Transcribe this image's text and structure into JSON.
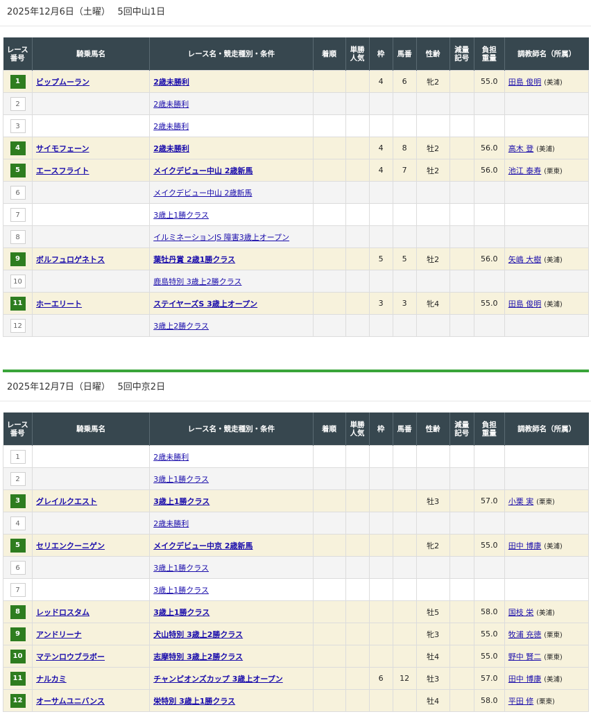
{
  "headers": {
    "race_no": [
      "レース",
      "番号"
    ],
    "horse": "騎乗馬名",
    "race": "レース名・競走種別・条件",
    "finish": "着順",
    "pop": [
      "単勝",
      "人気"
    ],
    "waku": "枠",
    "umaban": "馬番",
    "sexage": "性齢",
    "reduce": [
      "減量",
      "記号"
    ],
    "weight": [
      "負担",
      "重量"
    ],
    "trainer": "調教師名（所属）"
  },
  "days": [
    {
      "title": "2025年12月6日（土曜）　 5回中山1日",
      "rows": [
        {
          "no": "1",
          "on": true,
          "horse": "ビップムーラン",
          "race": "2歳未勝利",
          "strong": true,
          "finish": "",
          "pop": "",
          "waku": "4",
          "umaban": "6",
          "sexage": "牝2",
          "reduce": "",
          "weight": "55.0",
          "trainer": "田島 俊明",
          "aff": "(美浦)"
        },
        {
          "no": "2",
          "on": false,
          "horse": "",
          "race": "2歳未勝利",
          "strong": false,
          "finish": "",
          "pop": "",
          "waku": "",
          "umaban": "",
          "sexage": "",
          "reduce": "",
          "weight": "",
          "trainer": "",
          "aff": ""
        },
        {
          "no": "3",
          "on": false,
          "horse": "",
          "race": "2歳未勝利",
          "strong": false,
          "finish": "",
          "pop": "",
          "waku": "",
          "umaban": "",
          "sexage": "",
          "reduce": "",
          "weight": "",
          "trainer": "",
          "aff": ""
        },
        {
          "no": "4",
          "on": true,
          "horse": "サイモフェーン",
          "race": "2歳未勝利",
          "strong": true,
          "finish": "",
          "pop": "",
          "waku": "4",
          "umaban": "8",
          "sexage": "牡2",
          "reduce": "",
          "weight": "56.0",
          "trainer": "高木 登",
          "aff": "(美浦)"
        },
        {
          "no": "5",
          "on": true,
          "horse": "エースフライト",
          "race": "メイクデビュー中山 2歳新馬",
          "strong": true,
          "finish": "",
          "pop": "",
          "waku": "4",
          "umaban": "7",
          "sexage": "牡2",
          "reduce": "",
          "weight": "56.0",
          "trainer": "池江 泰寿",
          "aff": "(栗東)"
        },
        {
          "no": "6",
          "on": false,
          "horse": "",
          "race": "メイクデビュー中山 2歳新馬",
          "strong": false,
          "finish": "",
          "pop": "",
          "waku": "",
          "umaban": "",
          "sexage": "",
          "reduce": "",
          "weight": "",
          "trainer": "",
          "aff": ""
        },
        {
          "no": "7",
          "on": false,
          "horse": "",
          "race": "3歳上1勝クラス",
          "strong": false,
          "finish": "",
          "pop": "",
          "waku": "",
          "umaban": "",
          "sexage": "",
          "reduce": "",
          "weight": "",
          "trainer": "",
          "aff": ""
        },
        {
          "no": "8",
          "on": false,
          "horse": "",
          "race": "イルミネーションJS 障害3歳上オープン",
          "strong": false,
          "finish": "",
          "pop": "",
          "waku": "",
          "umaban": "",
          "sexage": "",
          "reduce": "",
          "weight": "",
          "trainer": "",
          "aff": ""
        },
        {
          "no": "9",
          "on": true,
          "horse": "ボルフュロゲネトス",
          "race": "葉牡丹賞 2歳1勝クラス",
          "strong": true,
          "finish": "",
          "pop": "",
          "waku": "5",
          "umaban": "5",
          "sexage": "牡2",
          "reduce": "",
          "weight": "56.0",
          "trainer": "矢嶋 大樹",
          "aff": "(美浦)"
        },
        {
          "no": "10",
          "on": false,
          "horse": "",
          "race": "鹿島特別 3歳上2勝クラス",
          "strong": false,
          "finish": "",
          "pop": "",
          "waku": "",
          "umaban": "",
          "sexage": "",
          "reduce": "",
          "weight": "",
          "trainer": "",
          "aff": ""
        },
        {
          "no": "11",
          "on": true,
          "horse": "ホーエリート",
          "race": "ステイヤーズS 3歳上オープン",
          "strong": true,
          "finish": "",
          "pop": "",
          "waku": "3",
          "umaban": "3",
          "sexage": "牝4",
          "reduce": "",
          "weight": "55.0",
          "trainer": "田島 俊明",
          "aff": "(美浦)"
        },
        {
          "no": "12",
          "on": false,
          "horse": "",
          "race": "3歳上2勝クラス",
          "strong": false,
          "finish": "",
          "pop": "",
          "waku": "",
          "umaban": "",
          "sexage": "",
          "reduce": "",
          "weight": "",
          "trainer": "",
          "aff": ""
        }
      ]
    },
    {
      "title": "2025年12月7日（日曜）　 5回中京2日",
      "rows": [
        {
          "no": "1",
          "on": false,
          "horse": "",
          "race": "2歳未勝利",
          "strong": false,
          "finish": "",
          "pop": "",
          "waku": "",
          "umaban": "",
          "sexage": "",
          "reduce": "",
          "weight": "",
          "trainer": "",
          "aff": ""
        },
        {
          "no": "2",
          "on": false,
          "horse": "",
          "race": "3歳上1勝クラス",
          "strong": false,
          "finish": "",
          "pop": "",
          "waku": "",
          "umaban": "",
          "sexage": "",
          "reduce": "",
          "weight": "",
          "trainer": "",
          "aff": ""
        },
        {
          "no": "3",
          "on": true,
          "horse": "グレイルクエスト",
          "race": "3歳上1勝クラス",
          "strong": true,
          "finish": "",
          "pop": "",
          "waku": "",
          "umaban": "",
          "sexage": "牡3",
          "reduce": "",
          "weight": "57.0",
          "trainer": "小栗 実",
          "aff": "(栗東)"
        },
        {
          "no": "4",
          "on": false,
          "horse": "",
          "race": "2歳未勝利",
          "strong": false,
          "finish": "",
          "pop": "",
          "waku": "",
          "umaban": "",
          "sexage": "",
          "reduce": "",
          "weight": "",
          "trainer": "",
          "aff": ""
        },
        {
          "no": "5",
          "on": true,
          "horse": "セリエンクーニゲン",
          "race": "メイクデビュー中京 2歳新馬",
          "strong": true,
          "finish": "",
          "pop": "",
          "waku": "",
          "umaban": "",
          "sexage": "牝2",
          "reduce": "",
          "weight": "55.0",
          "trainer": "田中 博康",
          "aff": "(美浦)"
        },
        {
          "no": "6",
          "on": false,
          "horse": "",
          "race": "3歳上1勝クラス",
          "strong": false,
          "finish": "",
          "pop": "",
          "waku": "",
          "umaban": "",
          "sexage": "",
          "reduce": "",
          "weight": "",
          "trainer": "",
          "aff": ""
        },
        {
          "no": "7",
          "on": false,
          "horse": "",
          "race": "3歳上1勝クラス",
          "strong": false,
          "finish": "",
          "pop": "",
          "waku": "",
          "umaban": "",
          "sexage": "",
          "reduce": "",
          "weight": "",
          "trainer": "",
          "aff": ""
        },
        {
          "no": "8",
          "on": true,
          "horse": "レッドロスタム",
          "race": "3歳上1勝クラス",
          "strong": true,
          "finish": "",
          "pop": "",
          "waku": "",
          "umaban": "",
          "sexage": "牡5",
          "reduce": "",
          "weight": "58.0",
          "trainer": "国枝 栄",
          "aff": "(美浦)"
        },
        {
          "no": "9",
          "on": true,
          "horse": "アンドリーナ",
          "race": "犬山特別 3歳上2勝クラス",
          "strong": true,
          "finish": "",
          "pop": "",
          "waku": "",
          "umaban": "",
          "sexage": "牝3",
          "reduce": "",
          "weight": "55.0",
          "trainer": "牧浦 充徳",
          "aff": "(栗東)"
        },
        {
          "no": "10",
          "on": true,
          "horse": "マテンロウブラボー",
          "race": "志摩特別 3歳上2勝クラス",
          "strong": true,
          "finish": "",
          "pop": "",
          "waku": "",
          "umaban": "",
          "sexage": "牡4",
          "reduce": "",
          "weight": "55.0",
          "trainer": "野中 賢二",
          "aff": "(栗東)"
        },
        {
          "no": "11",
          "on": true,
          "horse": "ナルカミ",
          "race": "チャンピオンズカップ 3歳上オープン",
          "strong": true,
          "finish": "",
          "pop": "",
          "waku": "6",
          "umaban": "12",
          "sexage": "牡3",
          "reduce": "",
          "weight": "57.0",
          "trainer": "田中 博康",
          "aff": "(美浦)"
        },
        {
          "no": "12",
          "on": true,
          "horse": "オーサムユニバンス",
          "race": "栄特別 3歳上1勝クラス",
          "strong": true,
          "finish": "",
          "pop": "",
          "waku": "",
          "umaban": "",
          "sexage": "牡4",
          "reduce": "",
          "weight": "58.0",
          "trainer": "平田 修",
          "aff": "(栗東)"
        }
      ]
    }
  ]
}
